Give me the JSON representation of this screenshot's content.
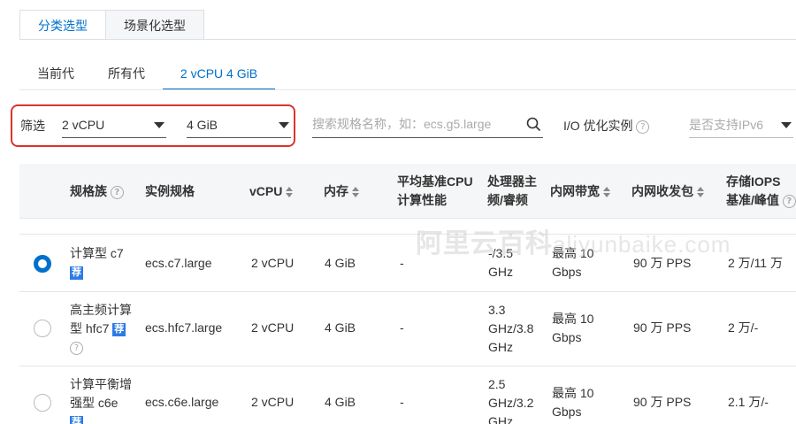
{
  "top_tabs": [
    {
      "label": "分类选型",
      "active": true
    },
    {
      "label": "场景化选型",
      "active": false
    }
  ],
  "sub_tabs": [
    {
      "label": "当前代",
      "active": false
    },
    {
      "label": "所有代",
      "active": false
    },
    {
      "label": "2 vCPU 4 GiB",
      "active": true
    }
  ],
  "filter": {
    "label": "筛选",
    "vcpu_value": "2 vCPU",
    "memory_value": "4 GiB",
    "search_placeholder": "搜索规格名称，如：ecs.g5.large",
    "io_label": "I/O 优化实例",
    "ipv6_placeholder": "是否支持IPv6"
  },
  "table": {
    "headers": {
      "family": "规格族",
      "spec": "实例规格",
      "vcpu": "vCPU",
      "memory": "内存",
      "baseline_1": "平均基准CPU",
      "baseline_2": "计算性能",
      "cpu_freq_1": "处理器主",
      "cpu_freq_2": "频/睿频",
      "bandwidth": "内网带宽",
      "pps": "内网收发包",
      "iops_1": "存储IOPS",
      "iops_2": "基准/峰值"
    },
    "rows": [
      {
        "selected": true,
        "family_1": "计算型 c7",
        "family_2": "",
        "tag": "荐",
        "spec": "ecs.c7.large",
        "vcpu": "2 vCPU",
        "memory": "4 GiB",
        "baseline": "-",
        "freq": [
          "-/3.5",
          "GHz"
        ],
        "bandwidth": [
          "最高 10",
          "Gbps"
        ],
        "pps": "90 万 PPS",
        "iops": "2 万/11 万"
      },
      {
        "selected": false,
        "family_1": "高主频计算",
        "family_2": "型 hfc7",
        "tag": "荐",
        "spec": "ecs.hfc7.large",
        "vcpu": "2 vCPU",
        "memory": "4 GiB",
        "baseline": "-",
        "freq": [
          "3.3",
          "GHz/3.8",
          "GHz"
        ],
        "bandwidth": [
          "最高 10",
          "Gbps"
        ],
        "pps": "90 万 PPS",
        "iops": "2 万/-"
      },
      {
        "selected": false,
        "family_1": "计算平衡增",
        "family_2": "强型 c6e",
        "tag": "荐",
        "spec": "ecs.c6e.large",
        "vcpu": "2 vCPU",
        "memory": "4 GiB",
        "baseline": "-",
        "freq": [
          "2.5",
          "GHz/3.2",
          "GHz"
        ],
        "bandwidth": [
          "最高 10",
          "Gbps"
        ],
        "pps": "90 万 PPS",
        "iops": "2.1 万/-"
      }
    ]
  },
  "watermark": {
    "cn": "阿里云百科",
    "en": "aliyunbaike.com"
  }
}
